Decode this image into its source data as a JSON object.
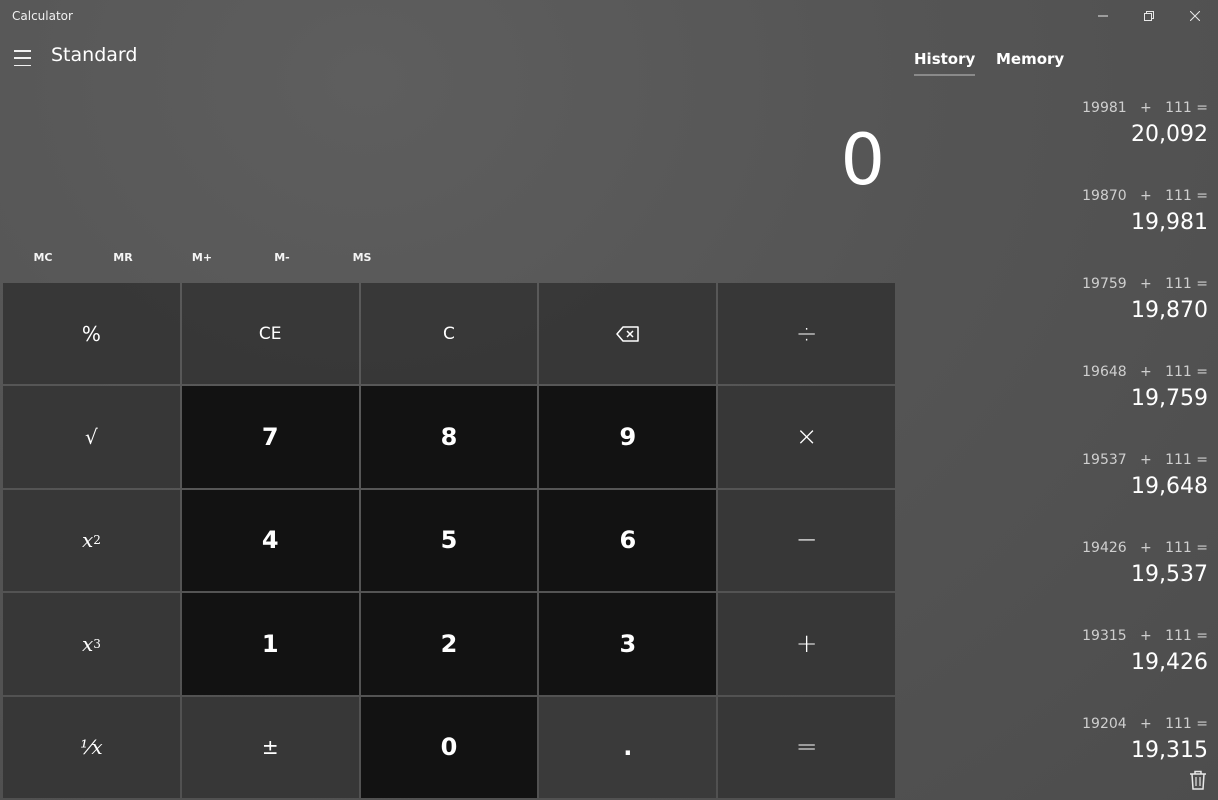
{
  "window": {
    "title": "Calculator",
    "minimize_icon": "minimize-icon",
    "maximize_icon": "restore-icon",
    "close_icon": "close-icon"
  },
  "header": {
    "menu_icon": "hamburger-icon",
    "mode": "Standard"
  },
  "display": {
    "value": "0"
  },
  "memory_buttons": [
    "MC",
    "MR",
    "M+",
    "M-",
    "MS"
  ],
  "keys": {
    "percent": "%",
    "ce": "CE",
    "c": "C",
    "backspace_icon": "backspace-icon",
    "divide": "÷",
    "sqrt": "√",
    "seven": "7",
    "eight": "8",
    "nine": "9",
    "multiply": "×",
    "square_base": "x",
    "square_exp": "2",
    "four": "4",
    "five": "5",
    "six": "6",
    "minus": "−",
    "cube_base": "x",
    "cube_exp": "3",
    "one": "1",
    "two": "2",
    "three": "3",
    "plus": "+",
    "reciprocal": "⅟x",
    "negate": "±",
    "zero": "0",
    "decimal": ".",
    "equals": "="
  },
  "panel": {
    "tabs": [
      "History",
      "Memory"
    ],
    "active_tab": "History",
    "trash_icon": "trash-icon"
  },
  "history": [
    {
      "expr": "19981   +   111 =",
      "result": "20,092"
    },
    {
      "expr": "19870   +   111 =",
      "result": "19,981"
    },
    {
      "expr": "19759   +   111 =",
      "result": "19,870"
    },
    {
      "expr": "19648   +   111 =",
      "result": "19,759"
    },
    {
      "expr": "19537   +   111 =",
      "result": "19,648"
    },
    {
      "expr": "19426   +   111 =",
      "result": "19,537"
    },
    {
      "expr": "19315   +   111 =",
      "result": "19,426"
    },
    {
      "expr": "19204   +   111 =",
      "result": "19,315"
    }
  ]
}
